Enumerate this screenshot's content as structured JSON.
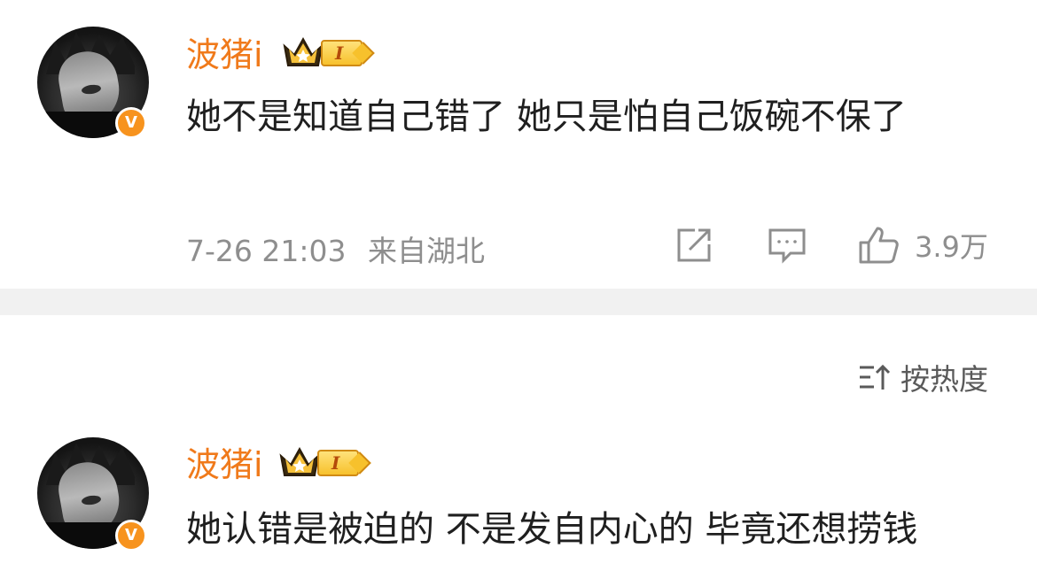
{
  "comments": [
    {
      "username": "波猪i",
      "level": "I",
      "verified_mark": "V",
      "text": "她不是知道自己错了 她只是怕自己饭碗不保了",
      "timestamp": "7-26 21:03",
      "location": "来自湖北",
      "likes": "3.9万"
    },
    {
      "username": "波猪i",
      "level": "I",
      "verified_mark": "V",
      "text": "她认错是被迫的 不是发自内心的 毕竟还想捞钱"
    }
  ],
  "sort": {
    "label": "按热度"
  },
  "colors": {
    "username": "#f07a1b",
    "badge": "#f7931e",
    "meta": "#8e8e8e",
    "divider": "#f1f1f1"
  },
  "icons": [
    "share-icon",
    "comment-icon",
    "like-icon",
    "sort-icon",
    "crown-icon",
    "verified-icon"
  ]
}
